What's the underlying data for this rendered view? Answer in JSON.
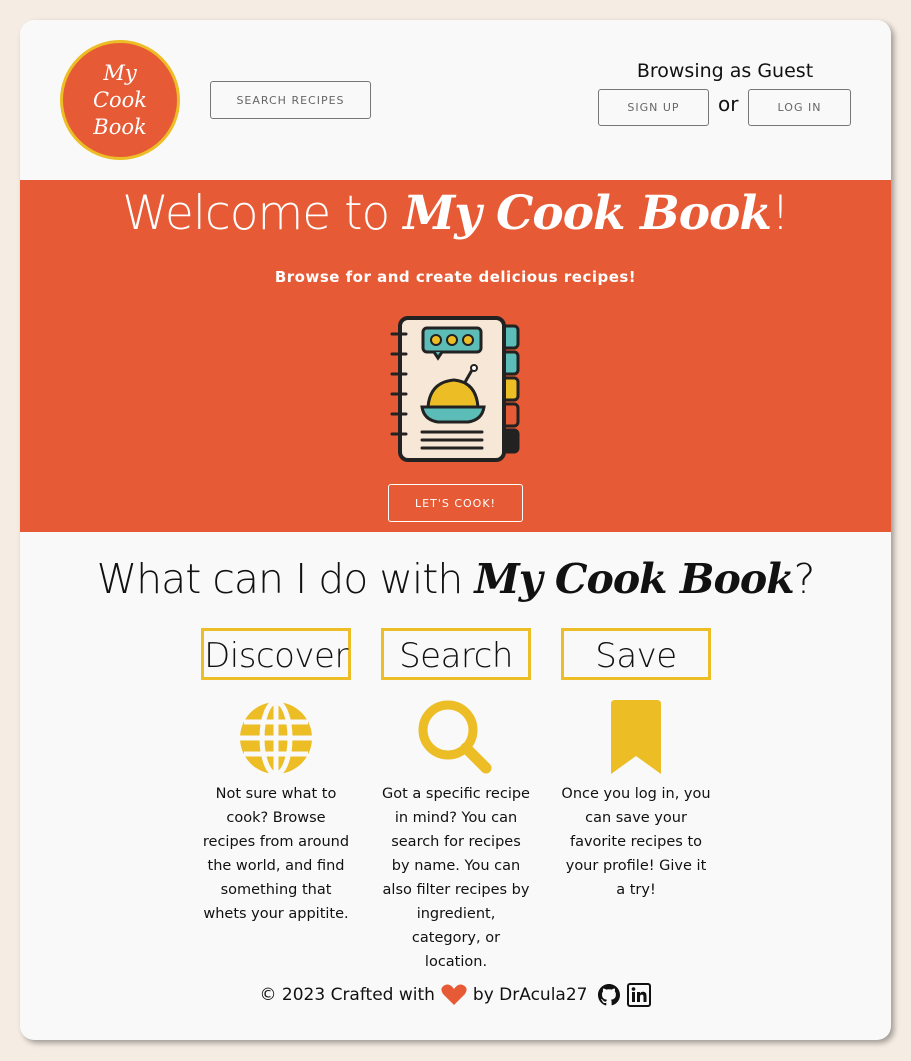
{
  "logo": {
    "line1": "My",
    "line2": "Cook Book"
  },
  "header": {
    "search_label": "SEARCH RECIPES",
    "guest_text": "Browsing as Guest",
    "signup_label": "SIGN UP",
    "or_text": "or",
    "login_label": "LOG IN"
  },
  "hero": {
    "title_prefix": "Welcome to ",
    "title_brand": "My Cook Book",
    "title_suffix": "!",
    "subtitle": "Browse for and create delicious recipes!",
    "button_label": "LET'S COOK!"
  },
  "features": {
    "heading_prefix": "What can I do with ",
    "heading_brand": "My Cook Book",
    "heading_suffix": "?",
    "items": [
      {
        "title": "Discover",
        "icon": "globe-icon",
        "text": "Not sure what to cook? Browse recipes from around the world, and find something that whets your appitite."
      },
      {
        "title": "Search",
        "icon": "magnifier-icon",
        "text": "Got a specific recipe in mind? You can search for recipes by name. You can also filter recipes by ingredient, category, or location."
      },
      {
        "title": "Save",
        "icon": "bookmark-icon",
        "text": "Once you log in, you can save your favorite recipes to your profile! Give it a try!"
      }
    ]
  },
  "footer": {
    "prefix": "© 2023 Crafted with",
    "suffix": "by DrAcula27",
    "heart_icon": "heart-icon",
    "links": [
      "github-icon",
      "linkedin-icon"
    ]
  },
  "colors": {
    "primary": "#e65a35",
    "accent": "#ecbd25",
    "card": "#f9f9f9",
    "background": "#f5ece3"
  }
}
